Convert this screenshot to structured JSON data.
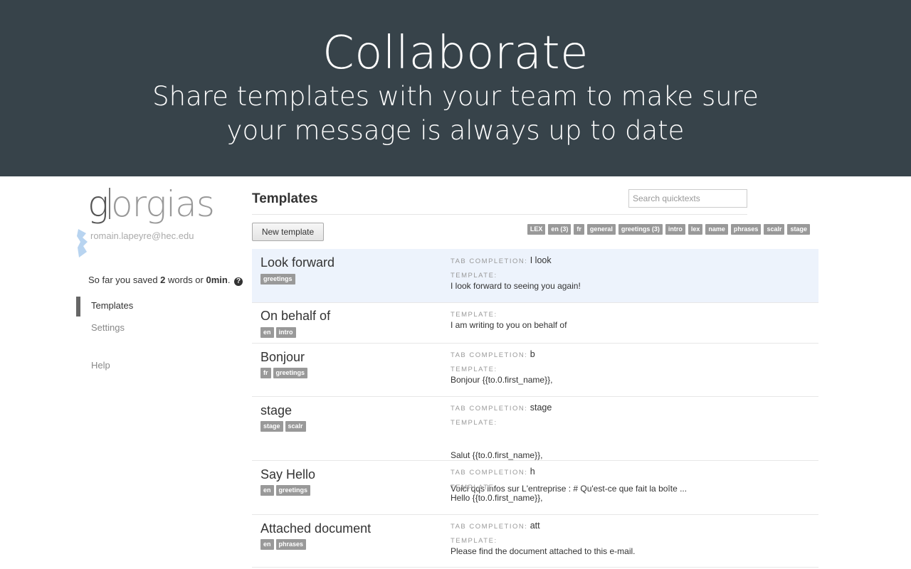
{
  "hero": {
    "title": "Collaborate",
    "subtitle_line1": "Share templates with your team to make sure",
    "subtitle_line2": "your message is always up to date"
  },
  "sidebar": {
    "logo_g": "g",
    "logo_rest": "orgias",
    "user_email": "romain.lapeyre@hec.edu",
    "saved_prefix": "So far you saved ",
    "saved_words": "2",
    "saved_mid": " words or ",
    "saved_time": "0min",
    "saved_suffix": ".",
    "help_glyph": "?",
    "nav": {
      "templates": "Templates",
      "settings": "Settings",
      "help": "Help"
    }
  },
  "header": {
    "title": "Templates",
    "search_placeholder": "Search quicktexts",
    "new_button": "New template"
  },
  "tag_filters": [
    "LEX",
    "en (3)",
    "fr",
    "general",
    "greetings (3)",
    "intro",
    "lex",
    "name",
    "phrases",
    "scalr",
    "stage"
  ],
  "labels": {
    "tab_completion": "TAB COMPLETION:",
    "template": "TEMPLATE:"
  },
  "templates": [
    {
      "title": "Look forward",
      "tags": [
        "greetings"
      ],
      "tab_completion": "I look",
      "body_line1": "I look forward to seeing you again!",
      "body_line2": ""
    },
    {
      "title": "On behalf of",
      "tags": [
        "en",
        "intro"
      ],
      "tab_completion": "",
      "body_line1": "I am writing to you on behalf of",
      "body_line2": ""
    },
    {
      "title": "Bonjour",
      "tags": [
        "fr",
        "greetings"
      ],
      "tab_completion": "b",
      "body_line1": "Bonjour {{to.0.first_name}},",
      "body_line2": ""
    },
    {
      "title": "stage",
      "tags": [
        "stage",
        "scalr"
      ],
      "tab_completion": "stage",
      "body_line1": "Salut {{to.0.first_name}},",
      "body_line2": "Voici qqs infos sur L'entreprise : # Qu'est-ce que fait la boîte ..."
    },
    {
      "title": "Say Hello",
      "tags": [
        "en",
        "greetings"
      ],
      "tab_completion": "h",
      "body_line1": "Hello {{to.0.first_name}},",
      "body_line2": ""
    },
    {
      "title": "Attached document",
      "tags": [
        "en",
        "phrases"
      ],
      "tab_completion": "att",
      "body_line1": "Please find the document attached to this e-mail.",
      "body_line2": ""
    }
  ],
  "colors": {
    "hero_bg": "#37434a",
    "selected_row": "#edf3fc",
    "tag_bg": "#999999"
  }
}
